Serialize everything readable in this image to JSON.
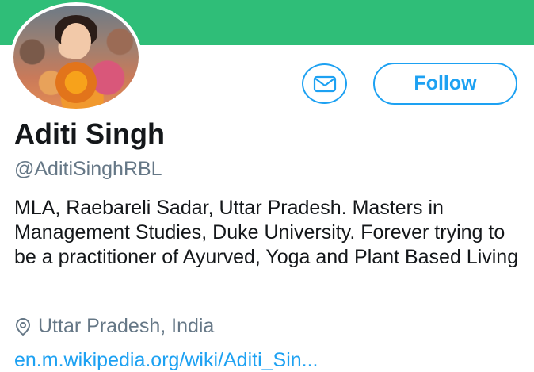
{
  "profile": {
    "name": "Aditi Singh",
    "handle": "@AditiSinghRBL",
    "bio": "MLA, Raebareli Sadar, Uttar Pradesh. Masters in Management Studies, Duke University. Forever trying to be a practitioner of Ayurved, Yoga and Plant Based Living",
    "location": "Uttar Pradesh, India",
    "website": "en.m.wikipedia.org/wiki/Aditi_Sin..."
  },
  "actions": {
    "follow_label": "Follow",
    "message_icon": "envelope-icon"
  },
  "colors": {
    "banner": "#2fbe78",
    "accent": "#1da1f2",
    "secondary_text": "#657786"
  }
}
